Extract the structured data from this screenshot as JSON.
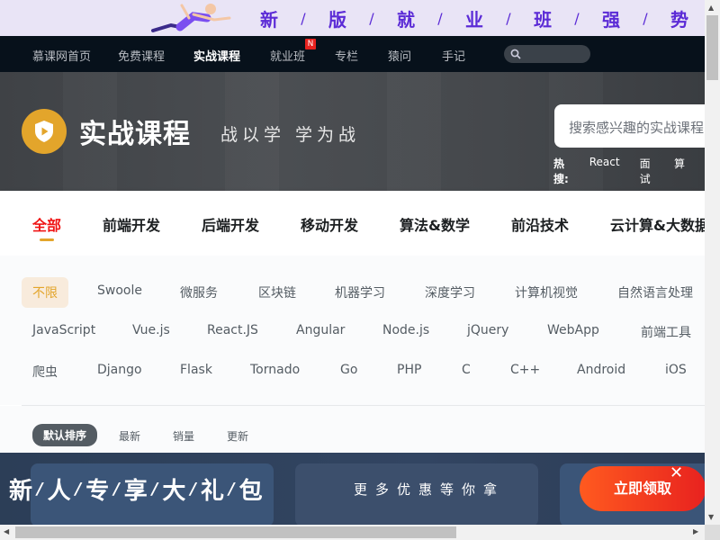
{
  "promo_banner": {
    "slogan": [
      "新",
      "版",
      "就",
      "业",
      "班",
      "强",
      "势"
    ],
    "separator": "/"
  },
  "nav": {
    "items": [
      {
        "label": "慕课网首页"
      },
      {
        "label": "免费课程"
      },
      {
        "label": "实战课程",
        "active": true
      },
      {
        "label": "就业班",
        "badge": "N"
      },
      {
        "label": "专栏"
      },
      {
        "label": "猿问"
      },
      {
        "label": "手记"
      }
    ],
    "search_icon": "search-icon"
  },
  "hero": {
    "title": "实战课程",
    "subtitle": "战以学 学为战",
    "search_placeholder": "搜索感兴趣的实战课程",
    "hot_label": "热搜:",
    "hot_items": [
      "React",
      "面试",
      "算"
    ]
  },
  "categories": [
    "全部",
    "前端开发",
    "后端开发",
    "移动开发",
    "算法&数学",
    "前沿技术",
    "云计算&大数据"
  ],
  "filters": {
    "row1": [
      "不限",
      "Swoole",
      "微服务",
      "区块链",
      "机器学习",
      "深度学习",
      "计算机视觉",
      "自然语言处理"
    ],
    "row2": [
      "JavaScript",
      "Vue.js",
      "React.JS",
      "Angular",
      "Node.js",
      "jQuery",
      "WebApp",
      "前端工具"
    ],
    "row3": [
      "爬虫",
      "Django",
      "Flask",
      "Tornado",
      "Go",
      "PHP",
      "C",
      "C++",
      "Android",
      "iOS"
    ]
  },
  "sort": [
    "默认排序",
    "最新",
    "销量",
    "更新"
  ],
  "bottom_promo": {
    "title_chars": [
      "新",
      "人",
      "专",
      "享",
      "大",
      "礼",
      "包"
    ],
    "separator": "/",
    "subtitle": "更多优惠等你拿",
    "button": "立即领取",
    "close": "✕"
  },
  "colors": {
    "accent": "#e3a52b",
    "nav_bg": "#07111b",
    "active_tab": "#f01414",
    "cta": "#e8221f"
  }
}
